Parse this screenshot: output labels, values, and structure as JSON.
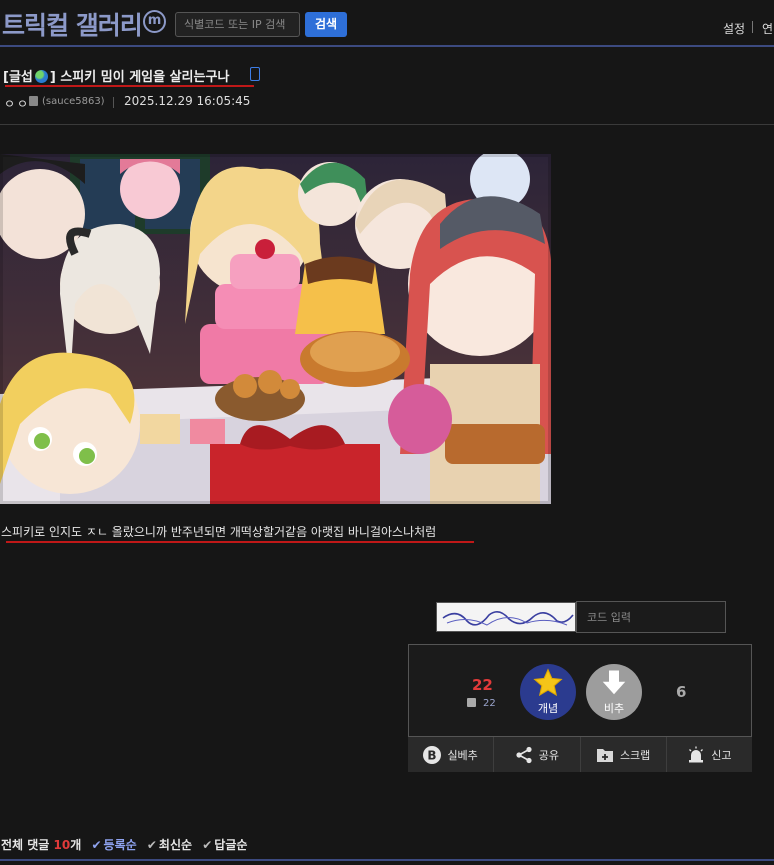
{
  "header": {
    "gallery_title": "트릭컬 갤러리",
    "minor_badge": "m",
    "search_placeholder": "식별코드 또는 IP 검색",
    "search_button": "검색",
    "settings": "설정",
    "more": "연"
  },
  "post": {
    "title_prefix": "[글섭",
    "title_main": "] 스피키 밈이 게임을 살리는구나",
    "author_name": "ㅇㅇ",
    "author_id": "(sauce5863)",
    "date": "2025.12.29 16:05:45",
    "body_text": "스피키로 인지도 ㅈㄴ 올랐으니까 반주년되면 개떡상할거같음 아랫집 바니걸아스나처럼",
    "icons": [
      "globe-icon",
      "mobile-icon",
      "fixed-member-icon"
    ]
  },
  "captcha": {
    "placeholder": "코드 입력"
  },
  "recommend": {
    "up_count": "22",
    "fixed_up_count": "22",
    "upvote_label": "개념",
    "downvote_label": "비추",
    "down_count": "6"
  },
  "actions": [
    {
      "label": "실베추",
      "icon": "b-badge-icon"
    },
    {
      "label": "공유",
      "icon": "share-icon"
    },
    {
      "label": "스크랩",
      "icon": "folder-plus-icon"
    },
    {
      "label": "신고",
      "icon": "siren-icon"
    }
  ],
  "comments": {
    "label": "전체 댓글",
    "count": "10",
    "unit": "개",
    "sort_options": [
      "등록순",
      "최신순",
      "답글순"
    ],
    "active_sort": "등록순"
  },
  "colors": {
    "accent": "#3c4a80",
    "title_blue": "#8c99c8",
    "red": "#e23a3a",
    "button_blue": "#2e6fd8",
    "upvote_bg": "#2b3b8f"
  }
}
